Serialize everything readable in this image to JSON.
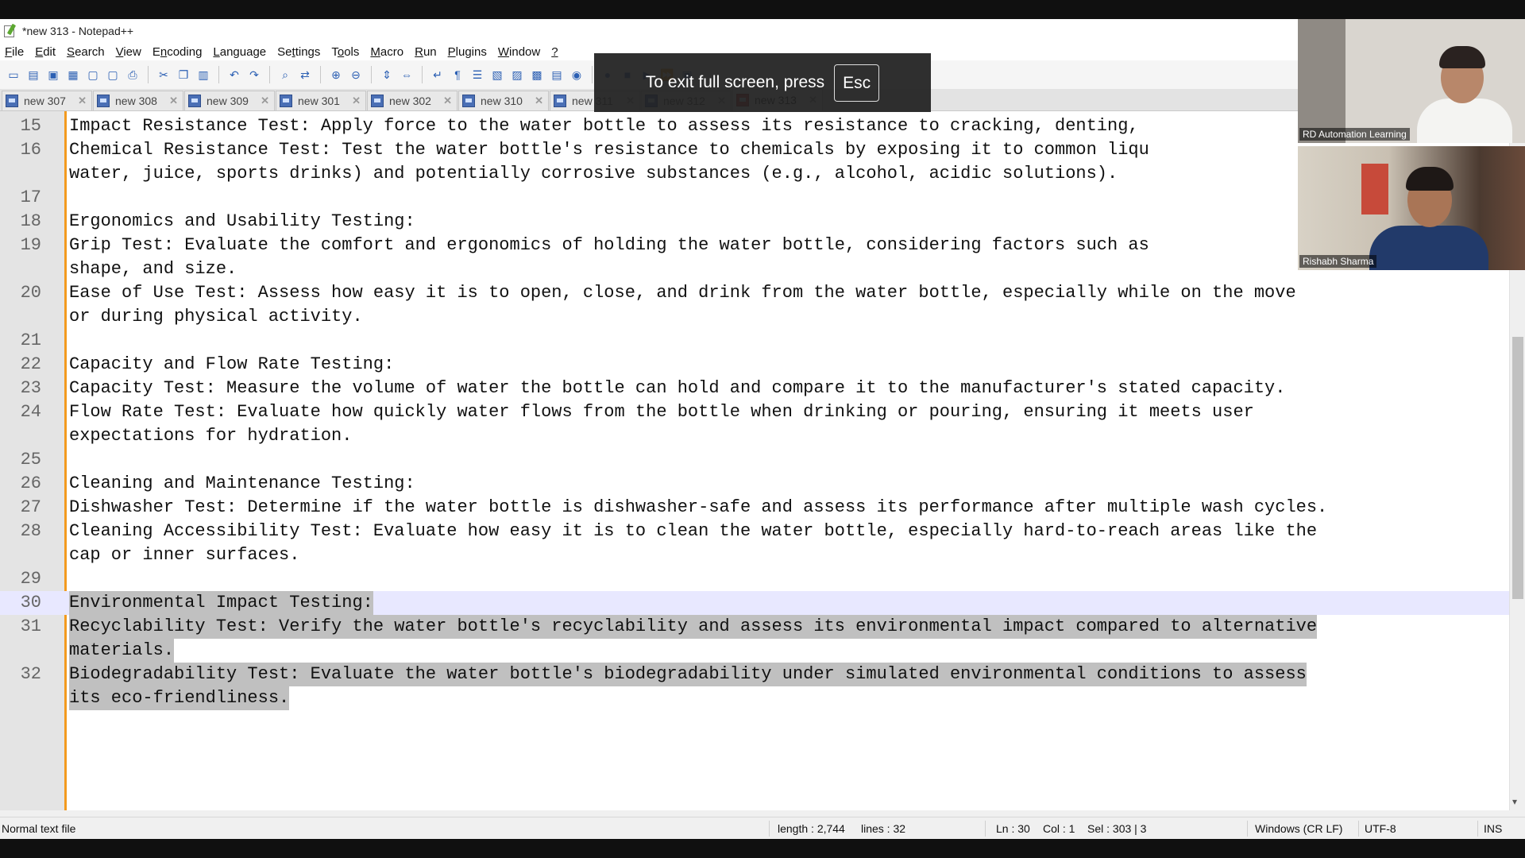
{
  "window": {
    "title": "*new 313 - Notepad++"
  },
  "menu": [
    {
      "pre": "",
      "u": "F",
      "post": "ile"
    },
    {
      "pre": "",
      "u": "E",
      "post": "dit"
    },
    {
      "pre": "",
      "u": "S",
      "post": "earch"
    },
    {
      "pre": "",
      "u": "V",
      "post": "iew"
    },
    {
      "pre": "E",
      "u": "n",
      "post": "coding"
    },
    {
      "pre": "",
      "u": "L",
      "post": "anguage"
    },
    {
      "pre": "Se",
      "u": "t",
      "post": "tings"
    },
    {
      "pre": "T",
      "u": "o",
      "post": "ols"
    },
    {
      "pre": "",
      "u": "M",
      "post": "acro"
    },
    {
      "pre": "",
      "u": "R",
      "post": "un"
    },
    {
      "pre": "",
      "u": "P",
      "post": "lugins"
    },
    {
      "pre": "",
      "u": "W",
      "post": "indow"
    },
    {
      "pre": "",
      "u": "?",
      "post": ""
    }
  ],
  "fullscreen_notice": {
    "text": "To exit full screen, press",
    "key": "Esc"
  },
  "tabs": [
    {
      "label": "new 307"
    },
    {
      "label": "new 308"
    },
    {
      "label": "new 309"
    },
    {
      "label": "new 301"
    },
    {
      "label": "new 302"
    },
    {
      "label": "new 310"
    },
    {
      "label": "new 311"
    },
    {
      "label": "new 312"
    },
    {
      "label": "new 313",
      "active": true
    }
  ],
  "editor_lines": [
    {
      "num": "15",
      "text": "Impact Resistance Test: Apply force to the water bottle to assess its resistance to cracking, denting,"
    },
    {
      "num": "16",
      "text": "Chemical Resistance Test: Test the water bottle's resistance to chemicals by exposing it to common liqu"
    },
    {
      "num": "",
      "text": "water, juice, sports drinks) and potentially corrosive substances (e.g., alcohol, acidic solutions)."
    },
    {
      "num": "17",
      "text": ""
    },
    {
      "num": "18",
      "text": "Ergonomics and Usability Testing:"
    },
    {
      "num": "19",
      "text": "Grip Test: Evaluate the comfort and ergonomics of holding the water bottle, considering factors such as"
    },
    {
      "num": "",
      "text": "shape, and size."
    },
    {
      "num": "20",
      "text": "Ease of Use Test: Assess how easy it is to open, close, and drink from the water bottle, especially while on the move"
    },
    {
      "num": "",
      "text": "or during physical activity."
    },
    {
      "num": "21",
      "text": ""
    },
    {
      "num": "22",
      "text": "Capacity and Flow Rate Testing:"
    },
    {
      "num": "23",
      "text": "Capacity Test: Measure the volume of water the bottle can hold and compare it to the manufacturer's stated capacity."
    },
    {
      "num": "24",
      "text": "Flow Rate Test: Evaluate how quickly water flows from the bottle when drinking or pouring, ensuring it meets user"
    },
    {
      "num": "",
      "text": "expectations for hydration."
    },
    {
      "num": "25",
      "text": ""
    },
    {
      "num": "26",
      "text": "Cleaning and Maintenance Testing:"
    },
    {
      "num": "27",
      "text": "Dishwasher Test: Determine if the water bottle is dishwasher-safe and assess its performance after multiple wash cycles."
    },
    {
      "num": "28",
      "text": "Cleaning Accessibility Test: Evaluate how easy it is to clean the water bottle, especially hard-to-reach areas like the"
    },
    {
      "num": "",
      "text": "cap or inner surfaces."
    },
    {
      "num": "29",
      "text": ""
    },
    {
      "num": "30",
      "text": "Environmental Impact Testing:",
      "selected": true,
      "current": true
    },
    {
      "num": "31",
      "text": "Recyclability Test: Verify the water bottle's recyclability and assess its environmental impact compared to alternative",
      "selected": true
    },
    {
      "num": "",
      "text": "materials.",
      "selected": true
    },
    {
      "num": "32",
      "text": "Biodegradability Test: Evaluate the water bottle's biodegradability under simulated environmental conditions to assess",
      "selected": true
    },
    {
      "num": "",
      "text": "its eco-friendliness.",
      "selected": true
    }
  ],
  "statusbar": {
    "file_type": "Normal text file",
    "length": "length : 2,744",
    "lines": "lines : 32",
    "ln": "Ln : 30",
    "col": "Col : 1",
    "sel": "Sel : 303 | 3",
    "eol": "Windows (CR LF)",
    "encoding": "UTF-8",
    "mode": "INS"
  },
  "participants": [
    {
      "name": "RD Automation Learning"
    },
    {
      "name": "Rishabh Sharma"
    }
  ]
}
